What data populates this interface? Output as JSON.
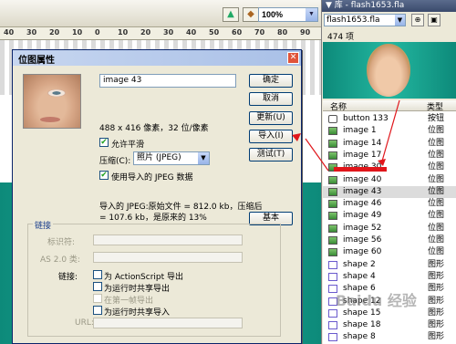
{
  "toolbar": {
    "zoom_value": "100%"
  },
  "ruler": {
    "ticks": [
      "40",
      "30",
      "20",
      "10",
      "0",
      "10",
      "20",
      "30",
      "40",
      "50",
      "60",
      "70",
      "80",
      "90"
    ]
  },
  "dialog": {
    "title": "位图属性",
    "name_value": "image 43",
    "dimensions": "488 x 416 像素，32 位/像素",
    "allow_smoothing_label": "允许平滑",
    "allow_smoothing_checked": true,
    "compression_label": "压缩(C):",
    "compression_value": "照片 (JPEG)",
    "use_imported_jpeg_label": "使用导入的 JPEG 数据",
    "use_imported_jpeg_checked": true,
    "info_line1": "导入的 JPEG:原始文件 = 812.0 kb，压缩后",
    "info_line2": "= 107.6 kb，是原来的 13%",
    "buttons": {
      "ok": "确定",
      "cancel": "取消",
      "update": "更新(U)",
      "import": "导入(I)",
      "test": "测试(T)",
      "basic": "基本"
    },
    "linkage": {
      "group_title": "链接",
      "identifier_label": "标识符:",
      "as2_class_label": "AS 2.0 类:",
      "linkage_label": "链接:",
      "export_as": "为 ActionScript 导出",
      "export_runtime": "为运行时共享导出",
      "export_first_frame": "在第一帧导出",
      "import_runtime": "为运行时共享导入",
      "url_label": "URL:"
    }
  },
  "library": {
    "title": "▼ 库 - flash1653.fla",
    "file_select": "flash1653.fla",
    "item_count": "474 项",
    "columns": {
      "name": "名称",
      "type": "类型"
    },
    "items": [
      {
        "name": "button 133",
        "type": "按钮",
        "kind": "button"
      },
      {
        "name": "image 1",
        "type": "位图",
        "kind": "bitmap"
      },
      {
        "name": "image 14",
        "type": "位图",
        "kind": "bitmap"
      },
      {
        "name": "image 17",
        "type": "位图",
        "kind": "bitmap"
      },
      {
        "name": "image 30",
        "type": "位图",
        "kind": "bitmap"
      },
      {
        "name": "image 40",
        "type": "位图",
        "kind": "bitmap"
      },
      {
        "name": "image 43",
        "type": "位图",
        "kind": "bitmap",
        "selected": true
      },
      {
        "name": "image 46",
        "type": "位图",
        "kind": "bitmap"
      },
      {
        "name": "image 49",
        "type": "位图",
        "kind": "bitmap"
      },
      {
        "name": "image 52",
        "type": "位图",
        "kind": "bitmap"
      },
      {
        "name": "image 56",
        "type": "位图",
        "kind": "bitmap"
      },
      {
        "name": "image 60",
        "type": "位图",
        "kind": "bitmap"
      },
      {
        "name": "shape 2",
        "type": "图形",
        "kind": "graphic"
      },
      {
        "name": "shape 4",
        "type": "图形",
        "kind": "graphic"
      },
      {
        "name": "shape 6",
        "type": "图形",
        "kind": "graphic"
      },
      {
        "name": "shape 12",
        "type": "图形",
        "kind": "graphic"
      },
      {
        "name": "shape 15",
        "type": "图形",
        "kind": "graphic"
      },
      {
        "name": "shape 18",
        "type": "图形",
        "kind": "graphic"
      },
      {
        "name": "shape 8",
        "type": "图形",
        "kind": "graphic"
      }
    ]
  },
  "colors": {
    "accent_red": "#e0161b",
    "teal": "#1fb39b"
  }
}
